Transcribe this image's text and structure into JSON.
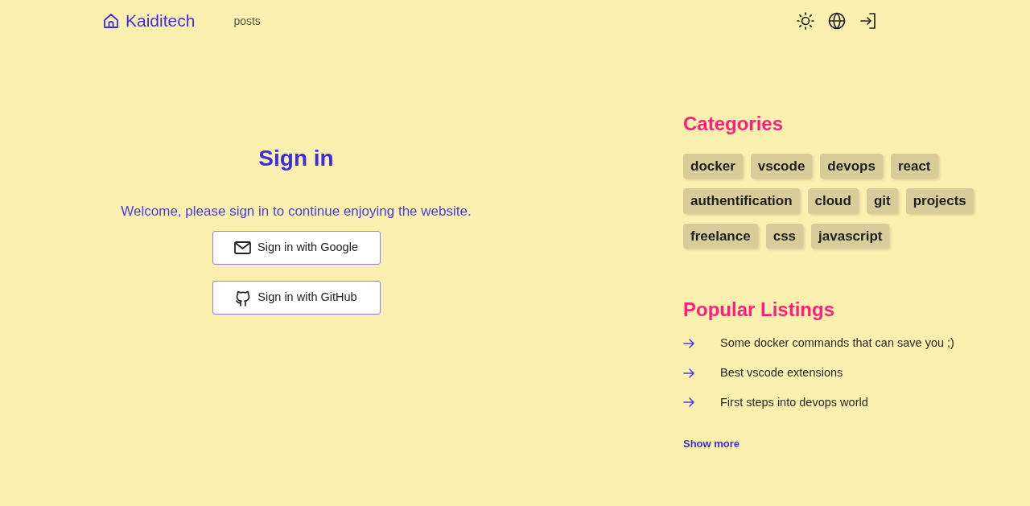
{
  "nav": {
    "brand": "Kaiditech",
    "links": [
      "posts"
    ]
  },
  "signin": {
    "title": "Sign in",
    "message": "Welcome, please sign in to continue enjoying the website.",
    "buttons": [
      {
        "kind": "google",
        "label": "Sign in with Google"
      },
      {
        "kind": "github",
        "label": "Sign in with GitHub"
      }
    ]
  },
  "categories": {
    "title": "Categories",
    "tags": [
      "docker",
      "vscode",
      "devops",
      "react",
      "authentification",
      "cloud",
      "git",
      "projects",
      "freelance",
      "css",
      "javascript"
    ]
  },
  "popular": {
    "title": "Popular Listings",
    "items": [
      "Some docker commands that can save you ;)",
      "Best vscode extensions",
      "First steps into devops world"
    ],
    "more": "Show more"
  }
}
